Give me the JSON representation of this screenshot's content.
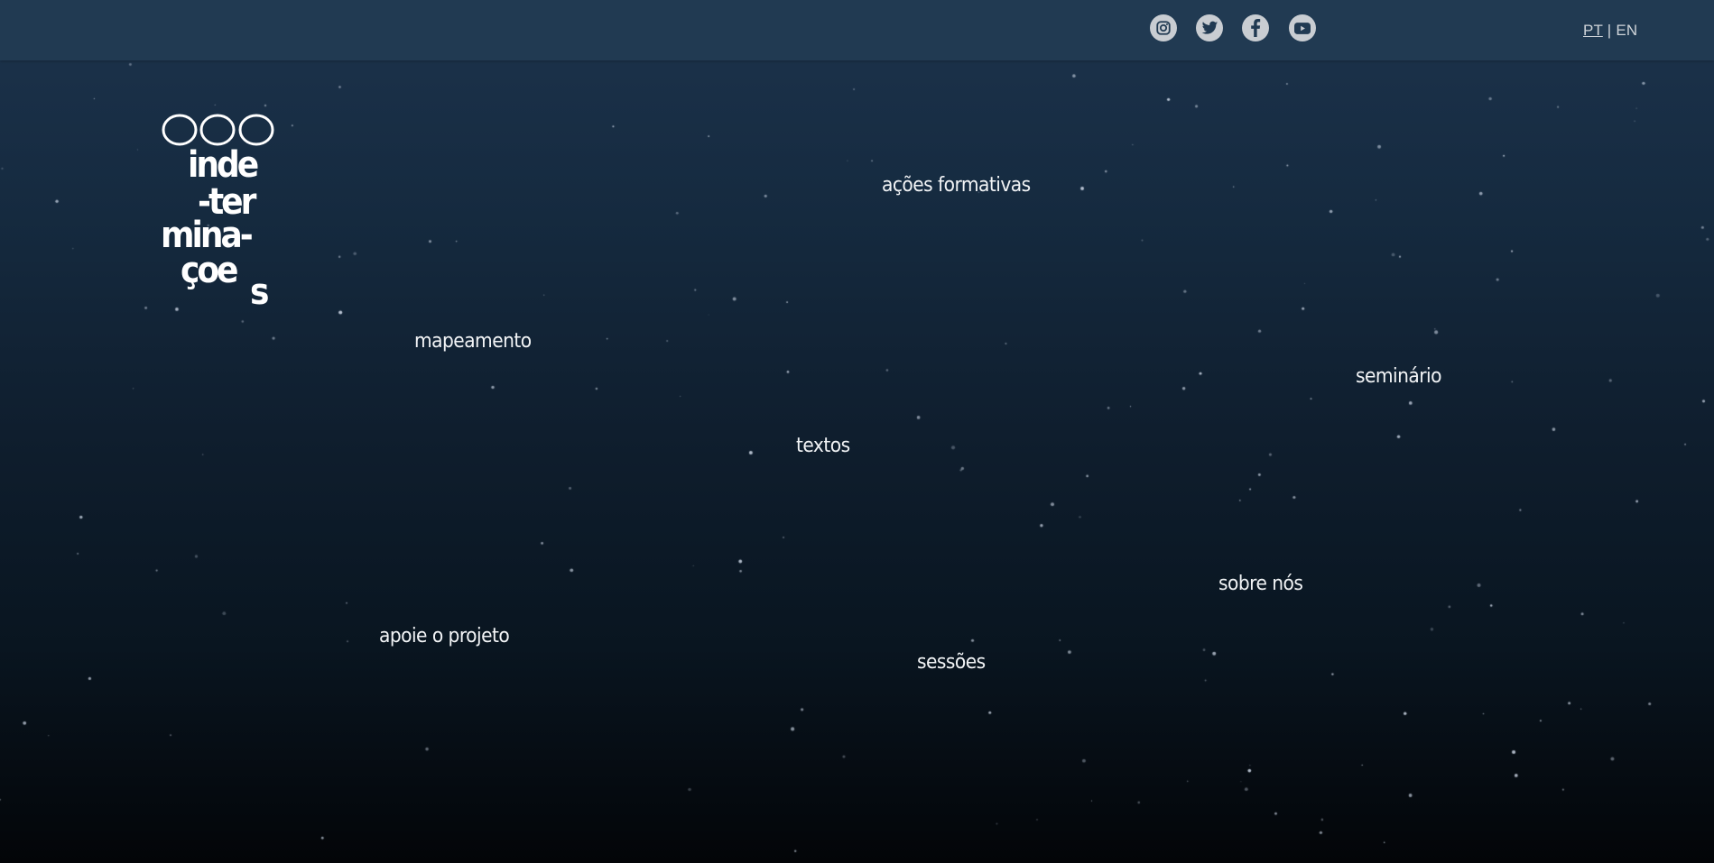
{
  "header": {
    "social": [
      {
        "icon": "instagram-icon",
        "label": "Instagram"
      },
      {
        "icon": "twitter-icon",
        "label": "Twitter"
      },
      {
        "icon": "facebook-icon",
        "label": "Facebook"
      },
      {
        "icon": "youtube-icon",
        "label": "YouTube"
      }
    ],
    "lang": {
      "pt": "PT",
      "sep": "|",
      "en": "EN",
      "active": "PT"
    }
  },
  "logo": {
    "lines": [
      "inde",
      "-ter",
      "mina-",
      "çoe",
      "s"
    ],
    "brand": "indeterminações"
  },
  "nav": {
    "acoes_formativas": "ações formativas",
    "mapeamento": "mapeamento",
    "seminario": "seminário",
    "textos": "textos",
    "sobre_nos": "sobre nós",
    "apoie_o_projeto": "apoie o projeto",
    "sessoes": "sessões"
  },
  "colors": {
    "topbar": "#213a52",
    "background_top": "#1f3850",
    "background_bottom": "#030508",
    "social_icon_bg": "#c9cdd2",
    "link": "#f2f4f6"
  }
}
